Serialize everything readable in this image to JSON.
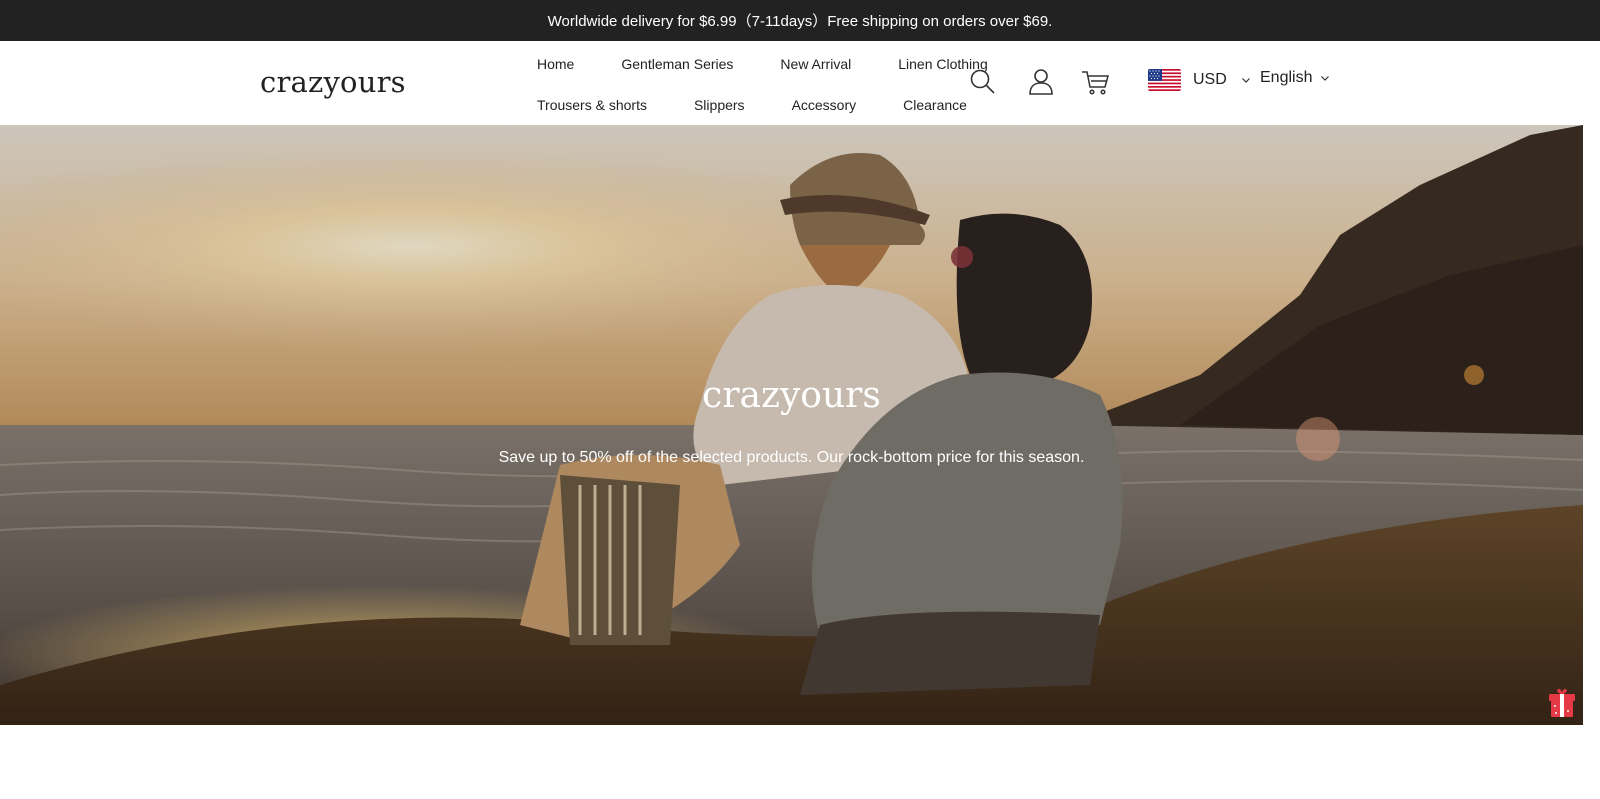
{
  "announcement": {
    "text": "Worldwide delivery for $6.99（7-11days）Free shipping on orders over $69."
  },
  "header": {
    "logo": "crazyours",
    "nav_row1": [
      "Home",
      "Gentleman Series",
      "New Arrival",
      "Linen Clothing"
    ],
    "nav_row2": [
      "Trousers & shorts",
      "Slippers",
      "Accessory",
      "Clearance"
    ],
    "icons": [
      "search-icon",
      "account-icon",
      "cart-icon"
    ],
    "currency": "USD",
    "language": "English"
  },
  "hero": {
    "title": "crazyours",
    "subtitle": "Save up to 50% off of the selected products. Our rock-bottom price for this season."
  },
  "colors": {
    "announcement_bg": "#222222",
    "text": "#222222",
    "hero_text": "#ffffff",
    "gift_red": "#e63946"
  }
}
